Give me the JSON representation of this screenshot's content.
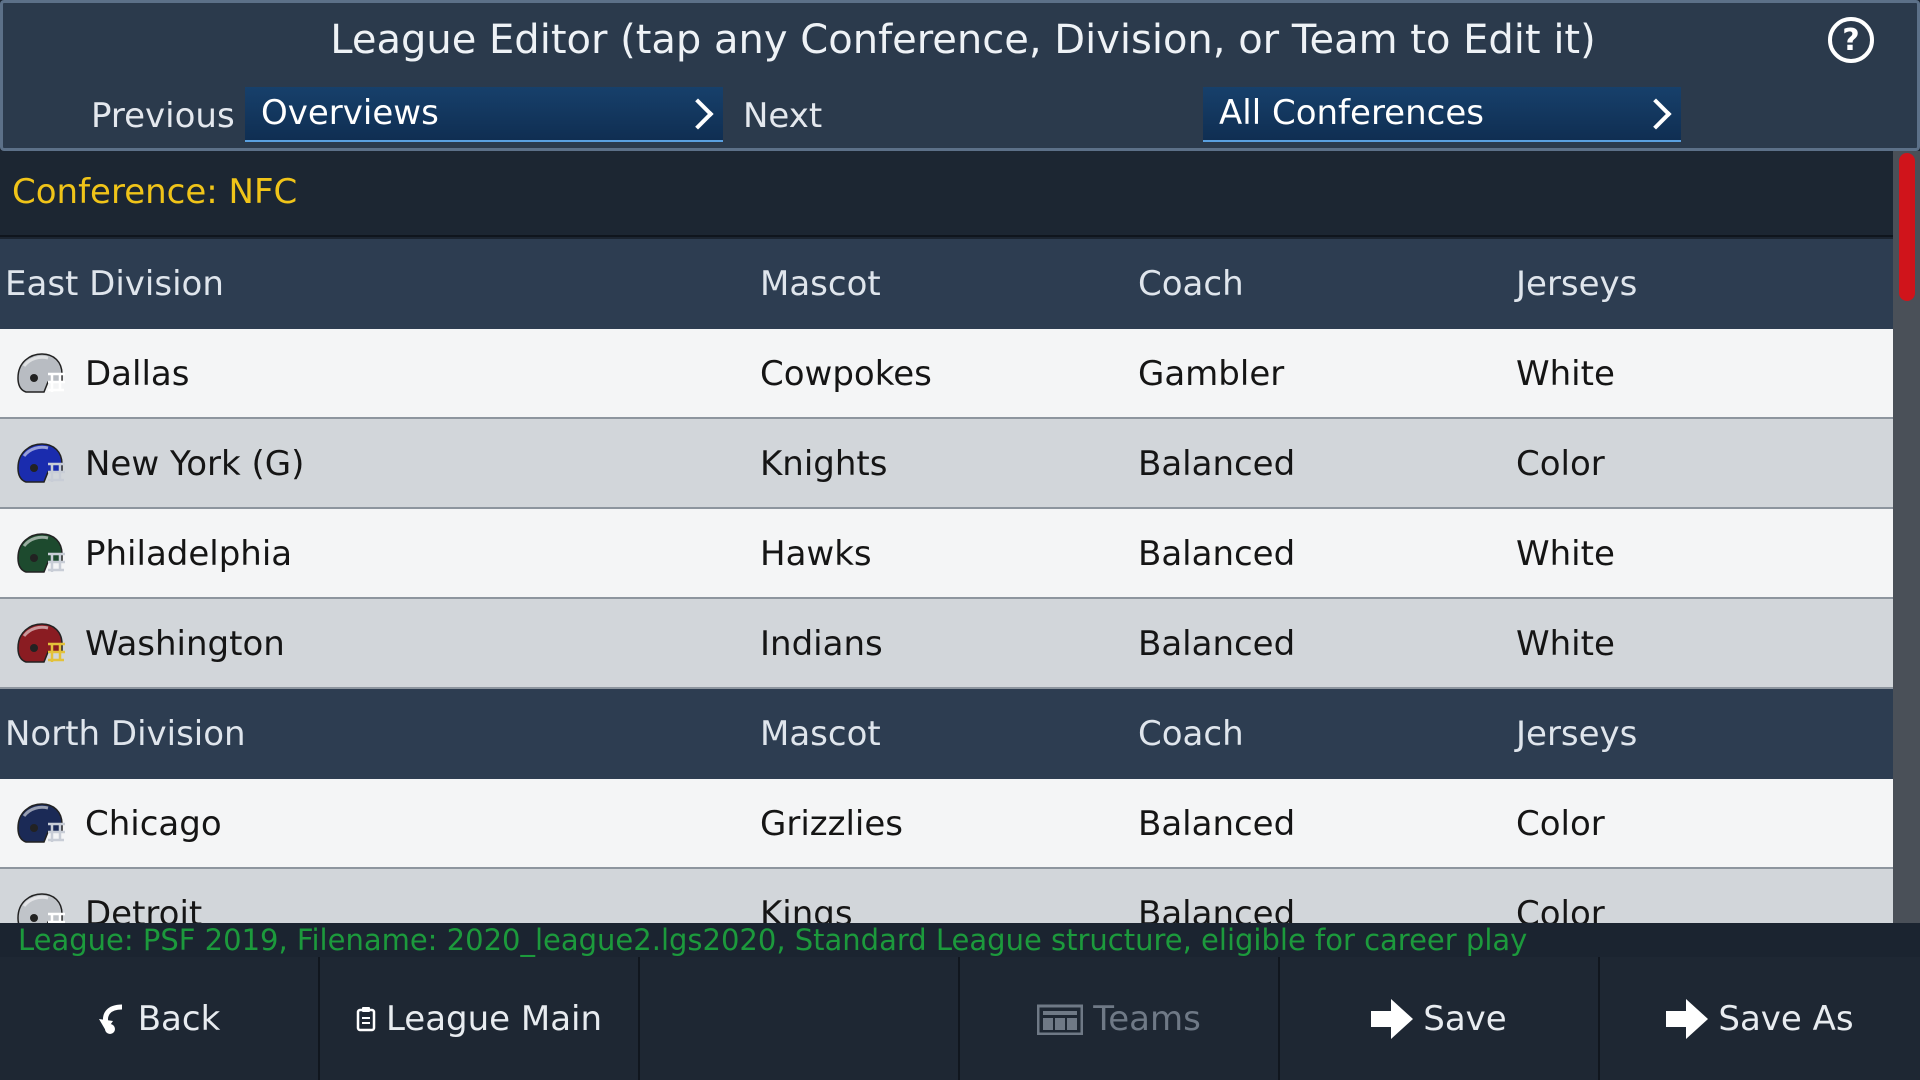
{
  "header": {
    "title": "League Editor (tap any Conference, Division, or Team to Edit it)",
    "help_label": "?",
    "previous_label": "Previous",
    "next_label": "Next",
    "view_dropdown": "Overviews",
    "conference_dropdown": "All Conferences"
  },
  "table": {
    "conference_label": "Conference: NFC",
    "divisions": [
      {
        "name": "East Division",
        "columns": [
          "Mascot",
          "Coach",
          "Jerseys"
        ],
        "teams": [
          {
            "city": "Dallas",
            "mascot": "Cowpokes",
            "coach": "Gambler",
            "jerseys": "White",
            "helmet_color": "#b8bcc2",
            "facemask_color": "#ffffff"
          },
          {
            "city": "New York (G)",
            "mascot": "Knights",
            "coach": "Balanced",
            "jerseys": "Color",
            "helmet_color": "#1a2cae",
            "facemask_color": "#c8cdd6"
          },
          {
            "city": "Philadelphia",
            "mascot": "Hawks",
            "coach": "Balanced",
            "jerseys": "White",
            "helmet_color": "#1d4a2e",
            "facemask_color": "#c8cdd6"
          },
          {
            "city": "Washington",
            "mascot": "Indians",
            "coach": "Balanced",
            "jerseys": "White",
            "helmet_color": "#8a1c22",
            "facemask_color": "#e3c23a"
          }
        ]
      },
      {
        "name": "North Division",
        "columns": [
          "Mascot",
          "Coach",
          "Jerseys"
        ],
        "teams": [
          {
            "city": "Chicago",
            "mascot": "Grizzlies",
            "coach": "Balanced",
            "jerseys": "Color",
            "helmet_color": "#1b2a56",
            "facemask_color": "#c8cdd6"
          },
          {
            "city": "Detroit",
            "mascot": "Kings",
            "coach": "Balanced",
            "jerseys": "Color",
            "helmet_color": "#c0c4c9",
            "facemask_color": "#ffffff"
          }
        ]
      }
    ]
  },
  "status": {
    "text": "League: PSF 2019,  Filename: 2020_league2.lgs2020,  Standard League structure, eligible for career play"
  },
  "bottom": {
    "back": "Back",
    "league_main": "League Main",
    "empty": "",
    "teams": "Teams",
    "save": "Save",
    "save_as": "Save As"
  },
  "colors": {
    "accent_yellow": "#f0c419",
    "status_green": "#1c9a3c",
    "scroll_thumb": "#d0141b"
  }
}
